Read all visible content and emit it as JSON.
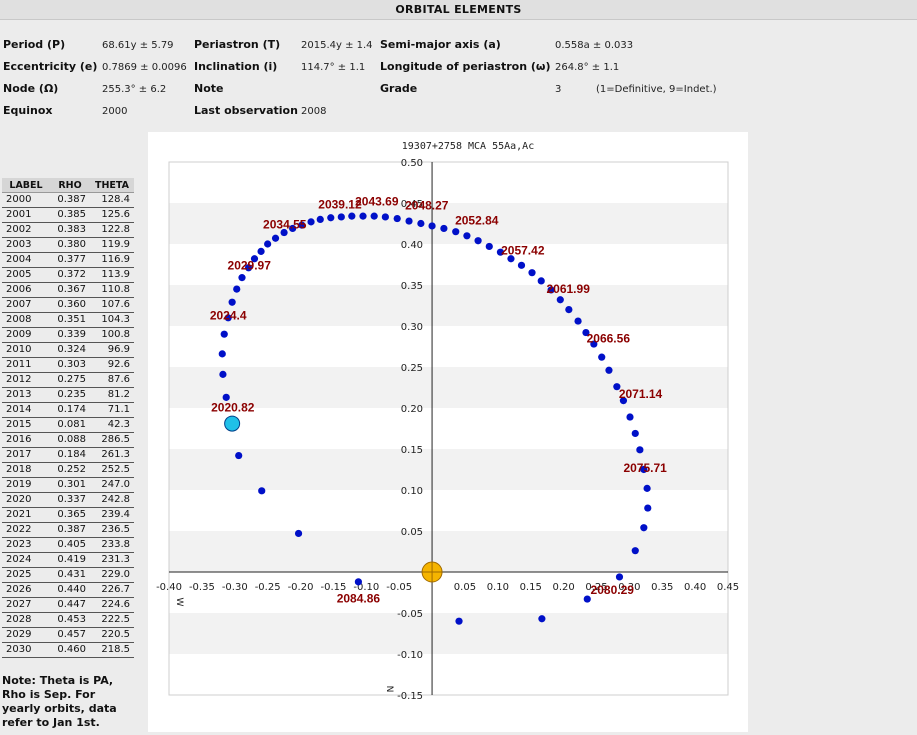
{
  "header": {
    "title": "ORBITAL ELEMENTS"
  },
  "elements": {
    "period_label": "Period (P)",
    "period_value": "68.61y ± 5.79",
    "periastron_label": "Periastron (T)",
    "periastron_value": "2015.4y ± 1.4",
    "semimajor_label": "Semi-major axis (a)",
    "semimajor_value": "0.558a ± 0.033",
    "ecc_label": "Eccentricity (e)",
    "ecc_value": "0.7869 ± 0.0096",
    "incl_label": "Inclination (i)",
    "incl_value": "114.7°  ± 1.1",
    "longperi_label": "Longitude of periastron (ω)",
    "longperi_value": "264.8° ± 1.1",
    "node_label": "Node (Ω)",
    "node_value": "255.3° ± 6.2",
    "note_label": "Note",
    "note_value": "",
    "grade_label": "Grade",
    "grade_value": "3",
    "grade_note": "(1=Definitive, 9=Indet.)",
    "equinox_label": "Equinox",
    "equinox_value": "2000",
    "lastobs_label": "Last observation",
    "lastobs_value": "2008"
  },
  "table": {
    "headers": [
      "LABEL",
      "RHO",
      "THETA"
    ],
    "rows": [
      [
        "2000",
        "0.387",
        "128.4"
      ],
      [
        "2001",
        "0.385",
        "125.6"
      ],
      [
        "2002",
        "0.383",
        "122.8"
      ],
      [
        "2003",
        "0.380",
        "119.9"
      ],
      [
        "2004",
        "0.377",
        "116.9"
      ],
      [
        "2005",
        "0.372",
        "113.9"
      ],
      [
        "2006",
        "0.367",
        "110.8"
      ],
      [
        "2007",
        "0.360",
        "107.6"
      ],
      [
        "2008",
        "0.351",
        "104.3"
      ],
      [
        "2009",
        "0.339",
        "100.8"
      ],
      [
        "2010",
        "0.324",
        "96.9"
      ],
      [
        "2011",
        "0.303",
        "92.6"
      ],
      [
        "2012",
        "0.275",
        "87.6"
      ],
      [
        "2013",
        "0.235",
        "81.2"
      ],
      [
        "2014",
        "0.174",
        "71.1"
      ],
      [
        "2015",
        "0.081",
        "42.3"
      ],
      [
        "2016",
        "0.088",
        "286.5"
      ],
      [
        "2017",
        "0.184",
        "261.3"
      ],
      [
        "2018",
        "0.252",
        "252.5"
      ],
      [
        "2019",
        "0.301",
        "247.0"
      ],
      [
        "2020",
        "0.337",
        "242.8"
      ],
      [
        "2021",
        "0.365",
        "239.4"
      ],
      [
        "2022",
        "0.387",
        "236.5"
      ],
      [
        "2023",
        "0.405",
        "233.8"
      ],
      [
        "2024",
        "0.419",
        "231.3"
      ],
      [
        "2025",
        "0.431",
        "229.0"
      ],
      [
        "2026",
        "0.440",
        "226.7"
      ],
      [
        "2027",
        "0.447",
        "224.6"
      ],
      [
        "2028",
        "0.453",
        "222.5"
      ],
      [
        "2029",
        "0.457",
        "220.5"
      ],
      [
        "2030",
        "0.460",
        "218.5"
      ]
    ],
    "note": "Note: Theta is PA, Rho is Sep. For yearly orbits, data refer to Jan 1st."
  },
  "chart_data": {
    "type": "scatter",
    "title": "19307+2758 MCA  55Aa,Ac",
    "xlim": [
      -0.4,
      0.45
    ],
    "ylim": [
      -0.15,
      0.5
    ],
    "x_ticks": [
      "-0.40",
      "-0.35",
      "-0.30",
      "-0.25",
      "-0.20",
      "-0.15",
      "-0.10",
      "-0.05",
      "0.05",
      "0.10",
      "0.15",
      "0.20",
      "0.25",
      "0.30",
      "0.35",
      "0.40",
      "0.45"
    ],
    "x_tick_values": [
      -0.4,
      -0.35,
      -0.3,
      -0.25,
      -0.2,
      -0.15,
      -0.1,
      -0.05,
      0.05,
      0.1,
      0.15,
      0.2,
      0.25,
      0.3,
      0.35,
      0.4,
      0.45
    ],
    "y_ticks": [
      "0.50",
      "0.45",
      "0.40",
      "0.35",
      "0.30",
      "0.25",
      "0.20",
      "0.15",
      "0.10",
      "0.05",
      "-0.05",
      "-0.10",
      "-0.15"
    ],
    "y_tick_values": [
      0.5,
      0.45,
      0.4,
      0.35,
      0.3,
      0.25,
      0.2,
      0.15,
      0.1,
      0.05,
      -0.05,
      -0.1,
      -0.15
    ],
    "west_label": "W",
    "north_label": "N",
    "grid": "horizontal bands",
    "colors": {
      "orbit": "#0010c8",
      "current": "#20c0e8",
      "primary": "#f5b400",
      "date_label": "#8b0000",
      "band": "#f2f2f2"
    },
    "orbit_points": [
      [
        -0.259,
        0.099
      ],
      [
        -0.294,
        0.142
      ],
      [
        -0.313,
        0.213
      ],
      [
        -0.318,
        0.241
      ],
      [
        -0.319,
        0.266
      ],
      [
        -0.316,
        0.29
      ],
      [
        -0.31,
        0.31
      ],
      [
        -0.304,
        0.329
      ],
      [
        -0.297,
        0.345
      ],
      [
        -0.289,
        0.359
      ],
      [
        -0.279,
        0.371
      ],
      [
        -0.27,
        0.382
      ],
      [
        -0.26,
        0.391
      ],
      [
        -0.25,
        0.4
      ],
      [
        -0.238,
        0.407
      ],
      [
        -0.225,
        0.414
      ],
      [
        -0.212,
        0.419
      ],
      [
        -0.198,
        0.423
      ],
      [
        -0.184,
        0.427
      ],
      [
        -0.17,
        0.43
      ],
      [
        -0.154,
        0.432
      ],
      [
        -0.138,
        0.433
      ],
      [
        -0.122,
        0.434
      ],
      [
        -0.105,
        0.434
      ],
      [
        -0.088,
        0.434
      ],
      [
        -0.071,
        0.433
      ],
      [
        -0.053,
        0.431
      ],
      [
        -0.035,
        0.428
      ],
      [
        -0.017,
        0.425
      ],
      [
        0.0,
        0.422
      ],
      [
        0.018,
        0.419
      ],
      [
        0.036,
        0.415
      ],
      [
        0.053,
        0.41
      ],
      [
        0.07,
        0.404
      ],
      [
        0.087,
        0.397
      ],
      [
        0.104,
        0.39
      ],
      [
        0.12,
        0.382
      ],
      [
        0.136,
        0.374
      ],
      [
        0.152,
        0.365
      ],
      [
        0.166,
        0.355
      ],
      [
        0.181,
        0.344
      ],
      [
        0.195,
        0.332
      ],
      [
        0.208,
        0.32
      ],
      [
        0.222,
        0.306
      ],
      [
        0.234,
        0.292
      ],
      [
        0.246,
        0.278
      ],
      [
        0.258,
        0.262
      ],
      [
        0.269,
        0.246
      ],
      [
        0.281,
        0.226
      ],
      [
        0.291,
        0.209
      ],
      [
        0.301,
        0.189
      ],
      [
        0.309,
        0.169
      ],
      [
        0.316,
        0.149
      ],
      [
        0.322,
        0.125
      ],
      [
        0.327,
        0.102
      ],
      [
        0.328,
        0.078
      ],
      [
        0.322,
        0.054
      ],
      [
        0.309,
        0.026
      ],
      [
        0.285,
        -0.006
      ],
      [
        0.236,
        -0.033
      ],
      [
        0.167,
        -0.057
      ],
      [
        0.041,
        -0.06
      ],
      [
        -0.112,
        -0.012
      ],
      [
        -0.203,
        0.047
      ]
    ],
    "current_point": [
      -0.304,
      0.181
    ],
    "primary_point": [
      0,
      0
    ],
    "date_labels": [
      {
        "text": "2020.82",
        "x": -0.303,
        "y": 0.196
      },
      {
        "text": "2024.4",
        "x": -0.31,
        "y": 0.308
      },
      {
        "text": "2029.97",
        "x": -0.278,
        "y": 0.369
      },
      {
        "text": "2034.55",
        "x": -0.224,
        "y": 0.419
      },
      {
        "text": "2039.12",
        "x": -0.14,
        "y": 0.443
      },
      {
        "text": "2043.69",
        "x": -0.084,
        "y": 0.447
      },
      {
        "text": "2048.27",
        "x": -0.008,
        "y": 0.442
      },
      {
        "text": "2052.84",
        "x": 0.068,
        "y": 0.424
      },
      {
        "text": "2057.42",
        "x": 0.138,
        "y": 0.387
      },
      {
        "text": "2061.99",
        "x": 0.207,
        "y": 0.34
      },
      {
        "text": "2066.56",
        "x": 0.268,
        "y": 0.28
      },
      {
        "text": "2071.14",
        "x": 0.317,
        "y": 0.212
      },
      {
        "text": "2075.71",
        "x": 0.324,
        "y": 0.122
      },
      {
        "text": "2080.29",
        "x": 0.274,
        "y": -0.027
      },
      {
        "text": "2084.86",
        "x": -0.112,
        "y": -0.037
      }
    ]
  }
}
